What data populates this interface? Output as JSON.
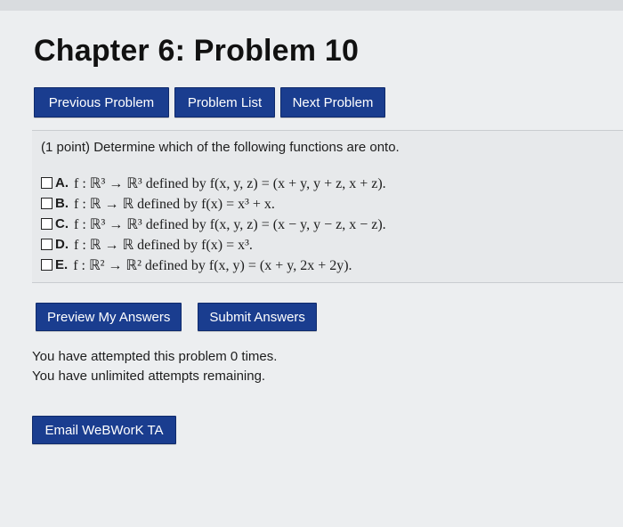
{
  "page": {
    "title": "Chapter 6: Problem 10"
  },
  "nav": {
    "previous": "Previous Problem",
    "list": "Problem List",
    "next": "Next Problem"
  },
  "problem": {
    "intro": "(1 point) Determine which of the following functions are onto.",
    "choices": [
      {
        "letter": "A.",
        "text": "f : ℝ³ → ℝ³ defined by f(x, y, z) = (x + y, y + z, x + z)."
      },
      {
        "letter": "B.",
        "text": "f : ℝ → ℝ defined by f(x) = x³ + x."
      },
      {
        "letter": "C.",
        "text": "f : ℝ³ → ℝ³ defined by f(x, y, z) = (x − y, y − z, x − z)."
      },
      {
        "letter": "D.",
        "text": "f : ℝ → ℝ defined by f(x) = x³."
      },
      {
        "letter": "E.",
        "text": "f : ℝ² → ℝ² defined by f(x, y) = (x + y, 2x + 2y)."
      }
    ]
  },
  "actions": {
    "preview": "Preview My Answers",
    "submit": "Submit Answers"
  },
  "attempts": {
    "line1": "You have attempted this problem 0 times.",
    "line2": "You have unlimited attempts remaining."
  },
  "email": {
    "label": "Email WeBWorK TA"
  },
  "colors": {
    "button": "#1a3d8f",
    "background": "#eceef0"
  }
}
